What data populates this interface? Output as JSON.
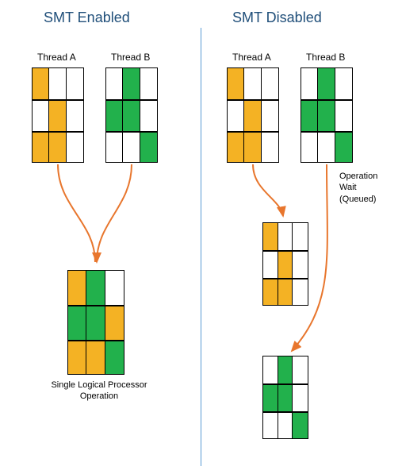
{
  "colors": {
    "title": "#1f4e79",
    "divider": "#5b9bd5",
    "orange": "#f4b224",
    "green": "#22b14c",
    "arrow": "#e8762d"
  },
  "panels": {
    "left": {
      "title": "SMT Enabled",
      "threadA_label": "Thread A",
      "threadB_label": "Thread B",
      "caption_line1": "Single Logical Processor",
      "caption_line2": "Operation",
      "threadA_cells": [
        [
          "o",
          "w",
          "w"
        ],
        [
          "w",
          "o",
          "w"
        ],
        [
          "o",
          "o",
          "w"
        ]
      ],
      "threadB_cells": [
        [
          "w",
          "g",
          "w"
        ],
        [
          "g",
          "g",
          "w"
        ],
        [
          "w",
          "w",
          "g"
        ]
      ],
      "merged_cells": [
        [
          "o",
          "g",
          "w"
        ],
        [
          "g",
          "g",
          "o"
        ],
        [
          "o",
          "o",
          "g"
        ]
      ]
    },
    "right": {
      "title": "SMT Disabled",
      "threadA_label": "Thread A",
      "threadB_label": "Thread B",
      "annotation_line1": "Operation",
      "annotation_line2": "Wait",
      "annotation_line3": "(Queued)",
      "threadA_cells": [
        [
          "o",
          "w",
          "w"
        ],
        [
          "w",
          "o",
          "w"
        ],
        [
          "o",
          "o",
          "w"
        ]
      ],
      "threadB_cells": [
        [
          "w",
          "g",
          "w"
        ],
        [
          "g",
          "g",
          "w"
        ],
        [
          "w",
          "w",
          "g"
        ]
      ],
      "exec_first_cells": [
        [
          "o",
          "w",
          "w"
        ],
        [
          "w",
          "o",
          "w"
        ],
        [
          "o",
          "o",
          "w"
        ]
      ],
      "exec_second_cells": [
        [
          "w",
          "g",
          "w"
        ],
        [
          "g",
          "g",
          "w"
        ],
        [
          "w",
          "w",
          "g"
        ]
      ]
    }
  }
}
